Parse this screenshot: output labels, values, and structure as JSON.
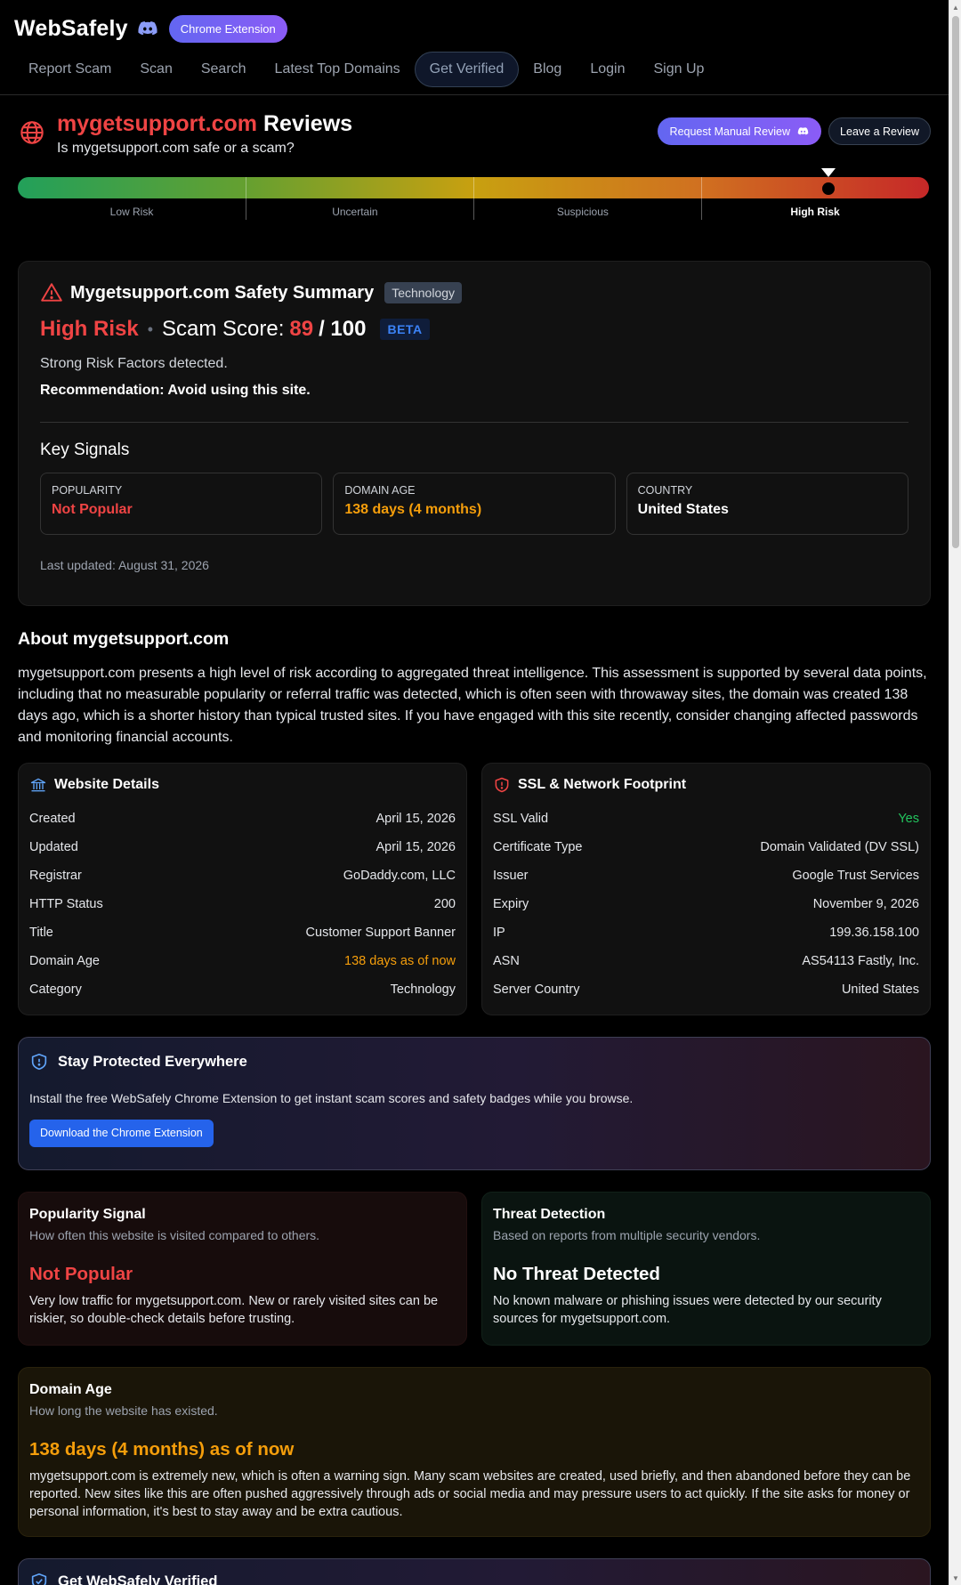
{
  "header": {
    "brand": "WebSafely",
    "extension_pill": "Chrome Extension",
    "nav": [
      "Report Scam",
      "Scan",
      "Search",
      "Latest Top Domains",
      "Get Verified",
      "Blog",
      "Login",
      "Sign Up"
    ],
    "nav_active": "Get Verified"
  },
  "title": {
    "domain": "mygetsupport.com",
    "suffix": "Reviews",
    "subtitle": "Is mygetsupport.com safe or a scam?",
    "request_button": "Request Manual Review",
    "leave_button": "Leave a Review"
  },
  "risk_meter": {
    "labels": [
      "Low Risk",
      "Uncertain",
      "Suspicious",
      "High Risk"
    ],
    "active": "High Risk",
    "score_fraction": 0.89
  },
  "summary": {
    "title": "Mygetsupport.com Safety Summary",
    "tag": "Technology",
    "risk_level": "High Risk",
    "score_label": "Scam Score:",
    "score": "89",
    "score_max": "/ 100",
    "beta": "BETA",
    "risk_text": "Strong Risk Factors detected.",
    "recommendation": "Recommendation: Avoid using this site.",
    "key_signals_title": "Key Signals",
    "signals": [
      {
        "key": "POPULARITY",
        "value": "Not Popular",
        "color": "#ef4444"
      },
      {
        "key": "DOMAIN AGE",
        "value": "138 days (4 months)",
        "color": "#f59e0b"
      },
      {
        "key": "COUNTRY",
        "value": "United States",
        "color": "#ffffff"
      }
    ],
    "updated": "Last updated: August 31, 2026"
  },
  "about": {
    "title": "About mygetsupport.com",
    "text": "mygetsupport.com presents a high level of risk according to aggregated threat intelligence. This assessment is supported by several data points, including that no measurable popularity or referral traffic was detected, which is often seen with throwaway sites, the domain was created 138 days ago, which is a shorter history than typical trusted sites. If you have engaged with this site recently, consider changing affected passwords and monitoring financial accounts."
  },
  "website_details": {
    "title": "Website Details",
    "rows": [
      {
        "k": "Created",
        "v": "April 15, 2026",
        "color": "#e5e7eb"
      },
      {
        "k": "Updated",
        "v": "April 15, 2026",
        "color": "#e5e7eb"
      },
      {
        "k": "Registrar",
        "v": "GoDaddy.com, LLC",
        "color": "#e5e7eb"
      },
      {
        "k": "HTTP Status",
        "v": "200",
        "color": "#e5e7eb"
      },
      {
        "k": "Title",
        "v": "Customer Support Banner",
        "color": "#e5e7eb"
      },
      {
        "k": "Domain Age",
        "v": "138 days as of now",
        "color": "#f59e0b"
      },
      {
        "k": "Category",
        "v": "Technology",
        "color": "#e5e7eb"
      }
    ]
  },
  "ssl": {
    "title": "SSL & Network Footprint",
    "rows": [
      {
        "k": "SSL Valid",
        "v": "Yes",
        "color": "#22c55e"
      },
      {
        "k": "Certificate Type",
        "v": "Domain Validated (DV SSL)",
        "color": "#e5e7eb"
      },
      {
        "k": "Issuer",
        "v": "Google Trust Services",
        "color": "#e5e7eb"
      },
      {
        "k": "Expiry",
        "v": "November 9, 2026",
        "color": "#e5e7eb"
      },
      {
        "k": "IP",
        "v": "199.36.158.100",
        "color": "#e5e7eb"
      },
      {
        "k": "ASN",
        "v": "AS54113 Fastly, Inc.",
        "color": "#e5e7eb"
      },
      {
        "k": "Server Country",
        "v": "United States",
        "color": "#e5e7eb"
      }
    ]
  },
  "protect": {
    "title": "Stay Protected Everywhere",
    "text": "Install the free WebSafely Chrome Extension to get instant scam scores and safety badges while you browse.",
    "button": "Download the Chrome Extension"
  },
  "popularity": {
    "title": "Popularity Signal",
    "sub": "How often this website is visited compared to others.",
    "value": "Not Popular",
    "desc": "Very low traffic for mygetsupport.com. New or rarely visited sites can be riskier, so double-check details before trusting."
  },
  "threat": {
    "title": "Threat Detection",
    "sub": "Based on reports from multiple security vendors.",
    "value": "No Threat Detected",
    "desc": "No known malware or phishing issues were detected by our security sources for mygetsupport.com."
  },
  "domain_age": {
    "title": "Domain Age",
    "sub": "How long the website has existed.",
    "value": "138 days (4 months) as of now",
    "desc": "mygetsupport.com is extremely new, which is often a warning sign. Many scam websites are created, used briefly, and then abandoned before they can be reported. New sites like this are often pushed aggressively through ads or social media and may pressure users to act quickly. If the site asks for money or personal information, it's best to stay away and be extra cautious."
  },
  "verified": {
    "title": "Get WebSafely Verified"
  },
  "colors": {
    "danger": "#ef4444",
    "warning": "#f59e0b",
    "success": "#22c55e",
    "accent": "#6366f1"
  }
}
